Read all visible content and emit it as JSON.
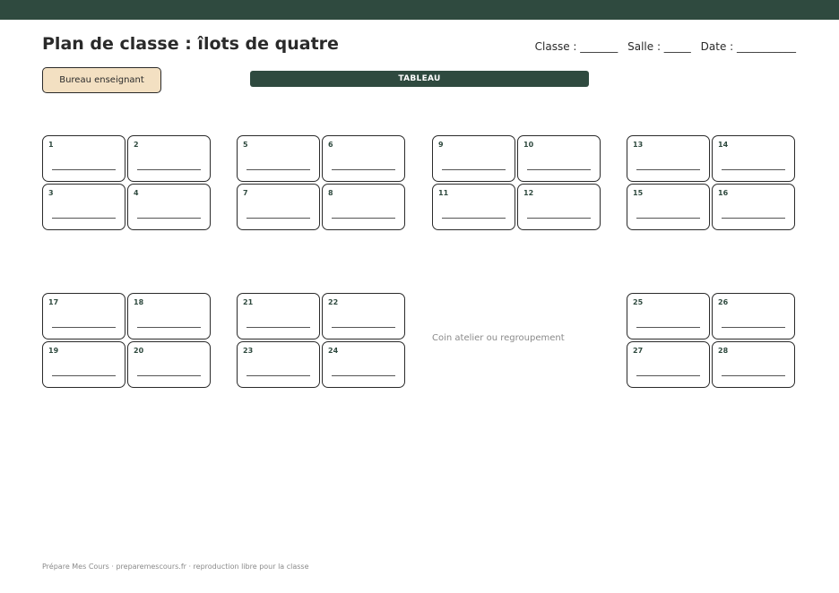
{
  "title": "Plan de classe : îlots de quatre",
  "meta": {
    "classe": "Classe : _______",
    "salle": "Salle : _____",
    "date": "Date : ___________"
  },
  "desk_label": "Bureau enseignant",
  "board_label": "TABLEAU",
  "seats": [
    "1",
    "2",
    "3",
    "4",
    "5",
    "6",
    "7",
    "8",
    "9",
    "10",
    "11",
    "12",
    "13",
    "14",
    "15",
    "16",
    "17",
    "18",
    "19",
    "20",
    "21",
    "22",
    "23",
    "24",
    "25",
    "26",
    "27",
    "28"
  ],
  "atelier_label": "Coin atelier ou regroupement",
  "footer": "Prépare Mes Cours · preparemescours.fr · reproduction libre pour la classe",
  "colors": {
    "accent": "#2f4a3f",
    "desk": "#f3e0c2"
  }
}
